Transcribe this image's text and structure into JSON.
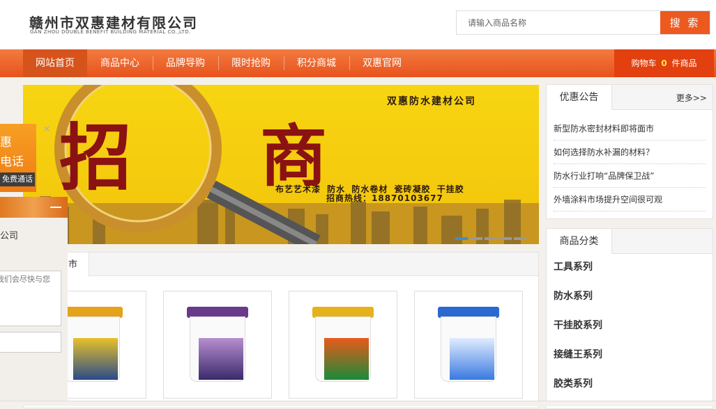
{
  "header": {
    "company_name": "赣州市双惠建材有限公司",
    "company_name_en": "GAN ZHOU DOUBLE BENEFIT BUILDING MATERIAL CO.,LTD.",
    "search_placeholder": "请输入商品名称",
    "search_button": "搜 索"
  },
  "nav": {
    "items": [
      "网站首页",
      "商品中心",
      "品牌导购",
      "限时抢购",
      "积分商城",
      "双惠官网"
    ],
    "cart_label": "购物车",
    "cart_count": "0",
    "cart_suffix": "件商品"
  },
  "banner": {
    "company": "双惠防水建材公司",
    "big_char_1": "招",
    "big_char_2": "商",
    "products": "布艺艺术漆 防水 防水卷材 瓷砖凝胶 干挂胶",
    "hotline": "招商热线：18870103677"
  },
  "notice": {
    "tab": "优惠公告",
    "more": "更多>>",
    "items": [
      "新型防水密封材料即将面市",
      "如何选择防水补漏的材料？",
      "防水行业打响“品牌保卫战”",
      "外墙涂料市场提升空间很可观"
    ]
  },
  "categories": {
    "tab": "商品分类",
    "items": [
      "工具系列",
      "防水系列",
      "干挂胶系列",
      "接缝王系列",
      "胶类系列"
    ]
  },
  "products": {
    "tab_label": "市"
  },
  "float_widget": {
    "line1": "惠",
    "line2": "电话",
    "call_button": "免费通话",
    "close": "×"
  },
  "chat": {
    "company": "公司",
    "message": "我们会尽快与您"
  },
  "colors": {
    "nav_orange": "#ed5a20",
    "banner_yellow": "#f7d512",
    "banner_red": "#8b1212"
  }
}
